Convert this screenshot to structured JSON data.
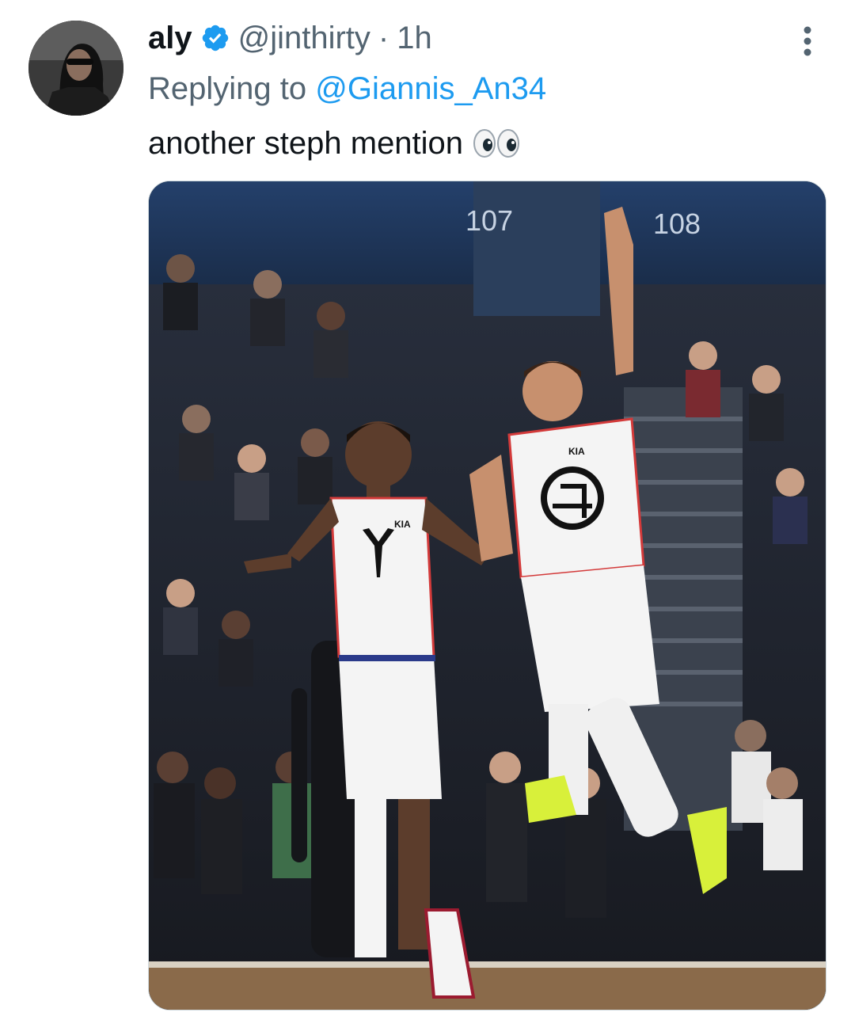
{
  "tweet": {
    "author_name": "aly",
    "author_handle": "@jinthirty",
    "separator": "·",
    "time": "1h",
    "replying_prefix": "Replying to",
    "replying_to": "@Giannis_An34",
    "text": "another steph mention",
    "emoji_icon": "eyes-emoji"
  },
  "photo": {
    "section_left": "107",
    "section_right": "108",
    "jersey_left_sponsor": "KIA",
    "jersey_right_sponsor": "KIA"
  },
  "colors": {
    "verified": "#1d9bf0",
    "link": "#1d9bf0",
    "secondary_text": "#536471",
    "primary_text": "#0f1419"
  }
}
